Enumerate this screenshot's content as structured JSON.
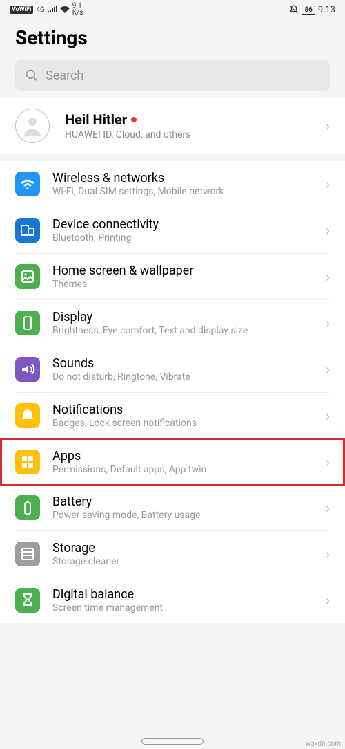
{
  "status": {
    "vowifi": "VoWiFi",
    "network": "4G",
    "speed": "9.1",
    "speed_unit": "K/s",
    "battery": "86",
    "time": "9:13"
  },
  "page_title": "Settings",
  "search": {
    "placeholder": "Search"
  },
  "profile": {
    "name": "Heil Hitler",
    "subtitle": "HUAWEI ID, Cloud, and others"
  },
  "items": [
    {
      "title": "Wireless & networks",
      "subtitle": "Wi-Fi, Dual SIM settings, Mobile network",
      "color": "ic-blue",
      "icon": "wifi",
      "highlighted": false
    },
    {
      "title": "Device connectivity",
      "subtitle": "Bluetooth, Printing",
      "color": "ic-darkblue",
      "icon": "devices",
      "highlighted": false
    },
    {
      "title": "Home screen & wallpaper",
      "subtitle": "Themes",
      "color": "ic-green",
      "icon": "image",
      "highlighted": false
    },
    {
      "title": "Display",
      "subtitle": "Brightness, Eye comfort, Text and display size",
      "color": "ic-green",
      "icon": "phone",
      "highlighted": false
    },
    {
      "title": "Sounds",
      "subtitle": "Do not disturb, Ringtone, Vibrate",
      "color": "ic-purple",
      "icon": "sound",
      "highlighted": false
    },
    {
      "title": "Notifications",
      "subtitle": "Badges, Lock screen notifications",
      "color": "ic-yellow",
      "icon": "bell",
      "highlighted": false
    },
    {
      "title": "Apps",
      "subtitle": "Permissions, Default apps, App twin",
      "color": "ic-yellow",
      "icon": "apps",
      "highlighted": true
    },
    {
      "title": "Battery",
      "subtitle": "Power saving mode, Battery usage",
      "color": "ic-green",
      "icon": "battery",
      "highlighted": false
    },
    {
      "title": "Storage",
      "subtitle": "Storage cleaner",
      "color": "ic-gray",
      "icon": "storage",
      "highlighted": false
    },
    {
      "title": "Digital balance",
      "subtitle": "Screen time management",
      "color": "ic-green",
      "icon": "hourglass",
      "highlighted": false
    }
  ],
  "watermark": "wsxdn.com"
}
